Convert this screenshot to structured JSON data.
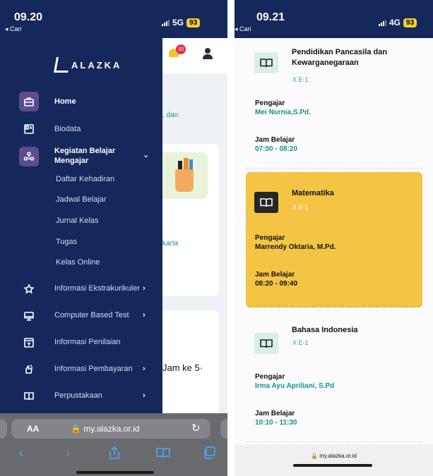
{
  "left_phone": {
    "status": {
      "time": "09.20",
      "back": "◂ Cari",
      "network": "5G",
      "battery": "93"
    },
    "logo_text": "ALAZKA",
    "menu": {
      "home": "Home",
      "biodata": "Biodata",
      "kbm": "Kegiatan Belajar Mengajar",
      "sub_items": [
        "Daftar Kehadiran",
        "Jadwal Belajar",
        "Jurnal Kelas",
        "Tugas",
        "Kelas Online"
      ],
      "ekstra": "Informasi Ekstrakurikuler",
      "cbt": "Computer Based Test",
      "penilaian": "Informasi Penilaian",
      "pembayaran": "Informasi Pembayaran",
      "perpustakaan": "Perpustakaan"
    },
    "behind": {
      "notif_count": "10",
      "peek_text_1": ", dan",
      "peek_text_2": "karta",
      "peek_text_3": "Jam ke 5·"
    },
    "safari": {
      "aa": "AA",
      "url": "🔒 my.alazka.or.id",
      "reload": "↻"
    }
  },
  "right_phone": {
    "status": {
      "time": "09.21",
      "back": "◂ Cari",
      "network": "4G",
      "battery": "93"
    },
    "schedule": [
      {
        "subject": "Pendidikan Pancasila dan Kewarganegaraan",
        "class": "X E-1",
        "teacher_label": "Pengajar",
        "teacher": "Mei Nurnia,S.Pd.",
        "time_label": "Jam Belajar",
        "time": "07:00 - 08:20"
      },
      {
        "subject": "Matematika",
        "class": "X E-1",
        "teacher_label": "Pengajar",
        "teacher": "Marrendy Oktaria, M.Pd.",
        "time_label": "Jam Belajar",
        "time": "08:20 - 09:40",
        "active": true
      },
      {
        "subject": "Bahasa Indonesia",
        "class": "X E-1",
        "teacher_label": "Pengajar",
        "teacher": "Irma Ayu Apriliani, S.Pd",
        "time_label": "Jam Belajar",
        "time": "10:10 - 11:30"
      }
    ],
    "bottom_url": "🔒 my.alazka.or.id"
  },
  "colors": {
    "navy": "#14285c",
    "active_card": "#f4c444",
    "teal": "#15928a",
    "accent_purple": "#5d4b8e"
  }
}
